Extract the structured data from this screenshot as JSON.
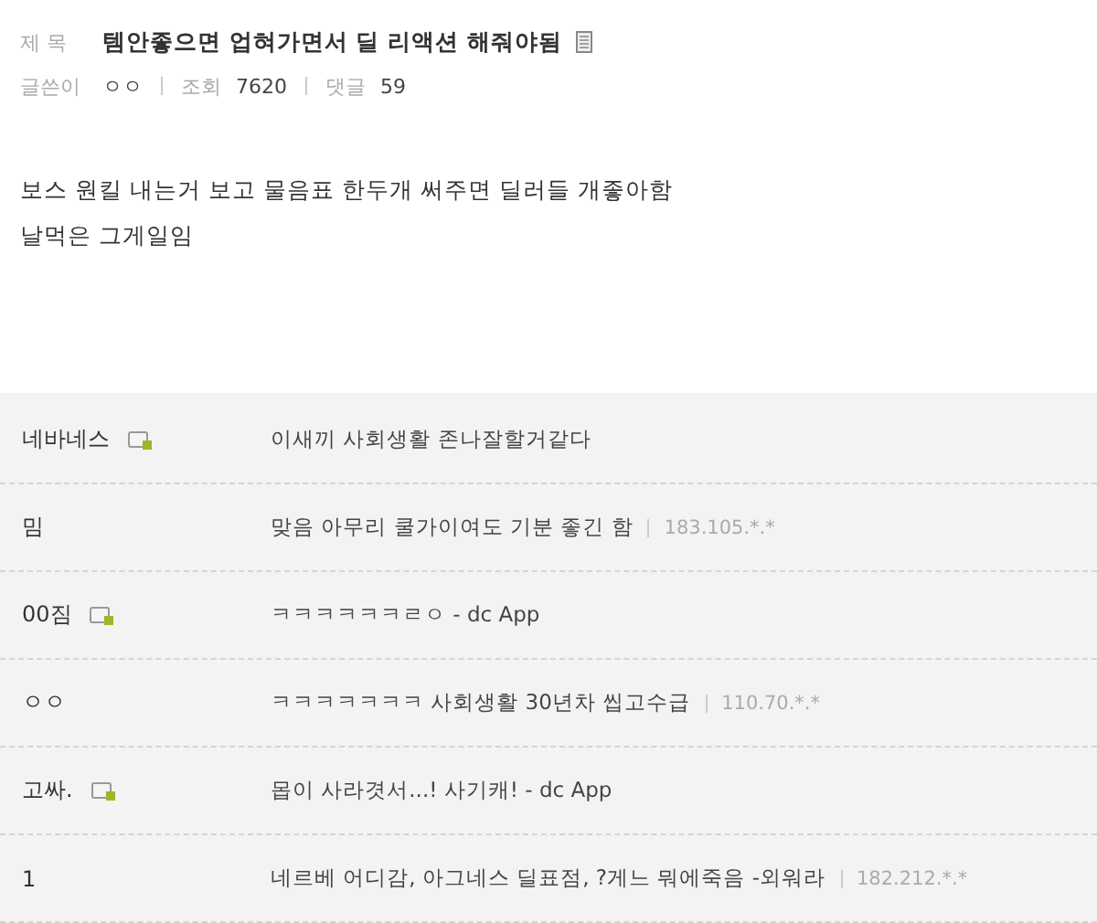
{
  "post": {
    "title_label": "제 목",
    "title": "템안좋으면 업혀가면서 딜 리액션 해줘야됨",
    "author_label": "글쓴이",
    "author": "ㅇㅇ",
    "views_label": "조회",
    "views": "7620",
    "comments_label": "댓글",
    "comments": "59",
    "body": [
      "보스 원킬 내는거 보고 물음표 한두개 써주면 딜러들 개좋아함",
      "날먹은 그게일임"
    ]
  },
  "comments": [
    {
      "nick": "네바네스",
      "member": true,
      "text": "이새끼 사회생활 존나잘할거같다"
    },
    {
      "nick": "밈",
      "member": false,
      "text": "맞음 아무리 쿨가이여도 기분 좋긴 함",
      "ip": "183.105.*.*"
    },
    {
      "nick": "00짐",
      "member": true,
      "text": "ㅋㅋㅋㅋㅋㅋㄹㅇ - dc App"
    },
    {
      "nick": "ㅇㅇ",
      "member": false,
      "text": "ㅋㅋㅋㅋㅋㅋㅋ 사회생활 30년차 씹고수급",
      "ip": "110.70.*.*"
    },
    {
      "nick": "고싸.",
      "member": true,
      "text": "몹이 사라겻서...! 사기캐! - dc App"
    },
    {
      "nick": "1",
      "member": false,
      "text": "네르베 어디감, 아그네스 딜표점, ?게느 뭐에죽음 -외워라",
      "ip": "182.212.*.*"
    }
  ]
}
